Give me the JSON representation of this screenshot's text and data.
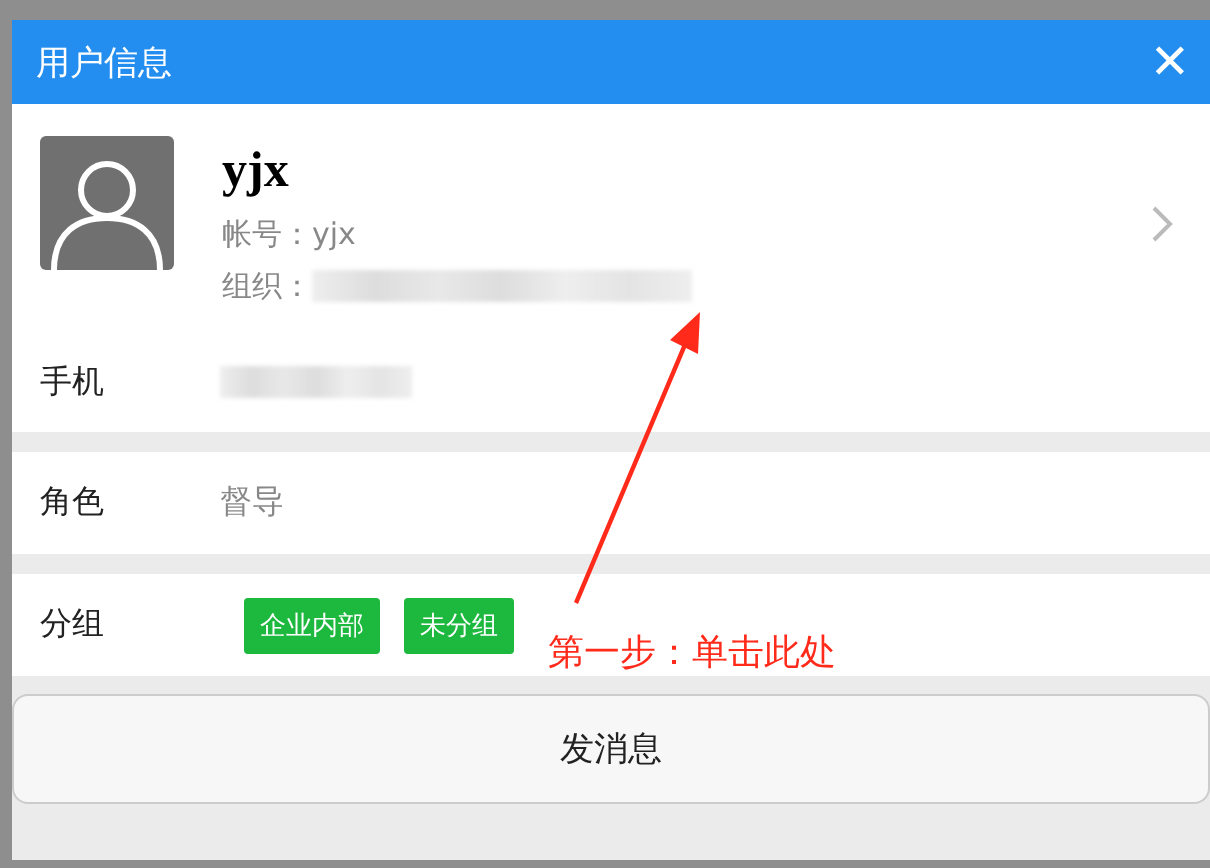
{
  "dialog": {
    "title": "用户信息",
    "close_icon": "✕"
  },
  "profile": {
    "name": "yjx",
    "fields": [
      {
        "kind": "text",
        "label": "帐号：",
        "value": "yjx"
      },
      {
        "kind": "redacted",
        "label": "组织："
      }
    ]
  },
  "rows": [
    {
      "kind": "redacted",
      "label": "手机"
    },
    {
      "kind": "text",
      "label": "角色",
      "value": "督导"
    },
    {
      "kind": "tags",
      "label": "分组",
      "tags": [
        "企业内部",
        "未分组"
      ]
    }
  ],
  "annotation": {
    "text": "第一步：单击此处"
  },
  "action_button": "发消息"
}
